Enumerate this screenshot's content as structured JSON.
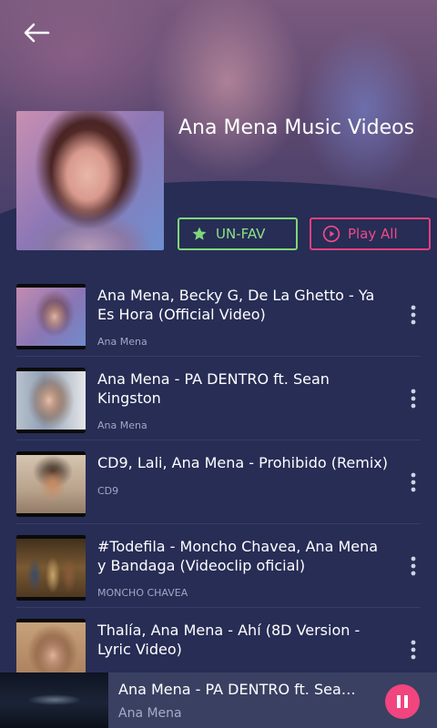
{
  "header": {
    "back_icon": "arrow-left-icon",
    "title": "Ana Mena Music Videos",
    "unfav_label": "UN-FAV",
    "unfav_icon": "star-icon",
    "play_all_label": "Play All",
    "play_all_icon": "play-circle-icon"
  },
  "videos": [
    {
      "title": "Ana Mena, Becky G, De La Ghetto - Ya Es Hora (Official Video)",
      "channel": "Ana Mena"
    },
    {
      "title": "Ana Mena - PA DENTRO ft. Sean Kingston",
      "channel": "Ana Mena"
    },
    {
      "title": "CD9, Lali, Ana Mena - Prohibido (Remix)",
      "channel": "CD9"
    },
    {
      "title": "#Todefila - Moncho Chavea, Ana Mena y Bandaga (Videoclip oficial)",
      "channel": "MONCHO CHAVEA"
    },
    {
      "title": "Thalía, Ana Mena - Ahí (8D Version - Lyric Video)",
      "channel": ""
    }
  ],
  "player": {
    "title": "Ana Mena - PA DENTRO ft. Sean...",
    "artist": "Ana Mena",
    "pause_icon": "pause-icon"
  },
  "colors": {
    "background": "#272d55",
    "unfav_accent": "#7fd67a",
    "play_accent": "#e0407f",
    "player_bg": "#3a4062"
  }
}
